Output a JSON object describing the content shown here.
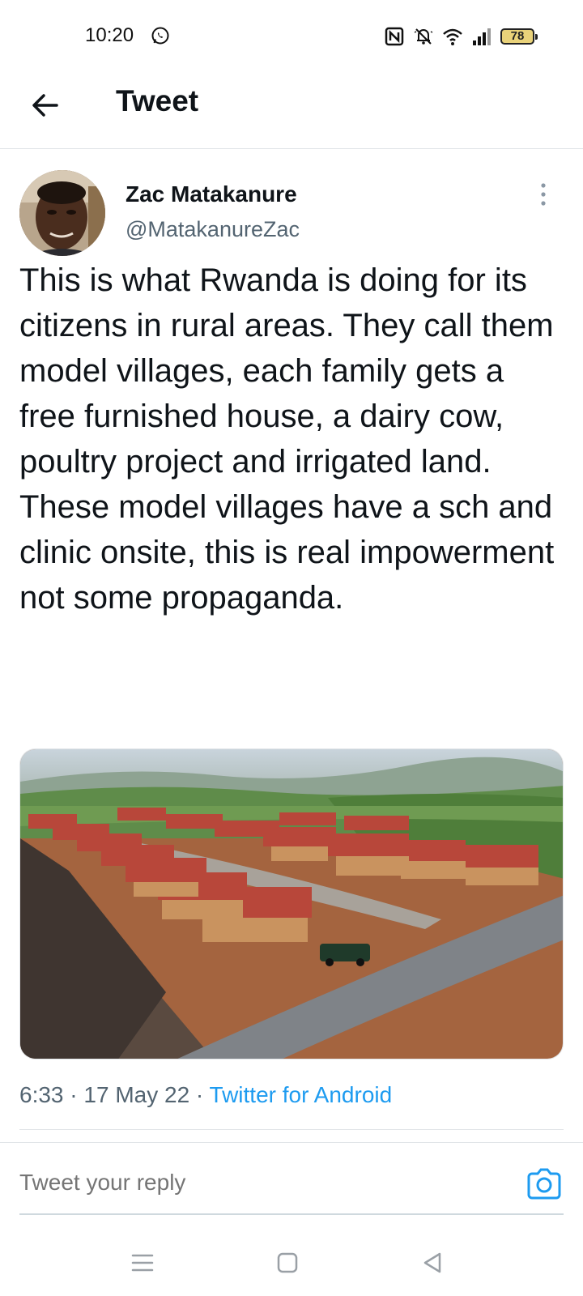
{
  "status_bar": {
    "time": "10:20",
    "battery": "78",
    "icons": [
      "whatsapp-icon",
      "nfc-icon",
      "silent-icon",
      "wifi-icon",
      "signal-icon",
      "battery-icon"
    ]
  },
  "header": {
    "title": "Tweet",
    "back_icon": "arrow-left-icon"
  },
  "tweet": {
    "author_name": "Zac Matakanure",
    "author_handle": "@MatakanureZac",
    "text": "This is what Rwanda is doing for its citizens in rural areas. They call them model villages, each family gets a free furnished house, a dairy cow, poultry project and irrigated land. These model villages have a sch and clinic onsite, this is real impowerment not some propaganda.",
    "time": "6:33",
    "date": "17 May 22",
    "separator": "·",
    "source": "Twitter for Android"
  },
  "reply": {
    "placeholder": "Tweet your reply",
    "camera_icon": "camera-icon"
  },
  "navbar": {
    "icons": [
      "menu-icon",
      "home-square-icon",
      "back-triangle-icon"
    ]
  },
  "colors": {
    "accent": "#1d9bf0",
    "muted": "#536471",
    "text": "#0f1419",
    "battery_fill": "#e9d27a"
  }
}
